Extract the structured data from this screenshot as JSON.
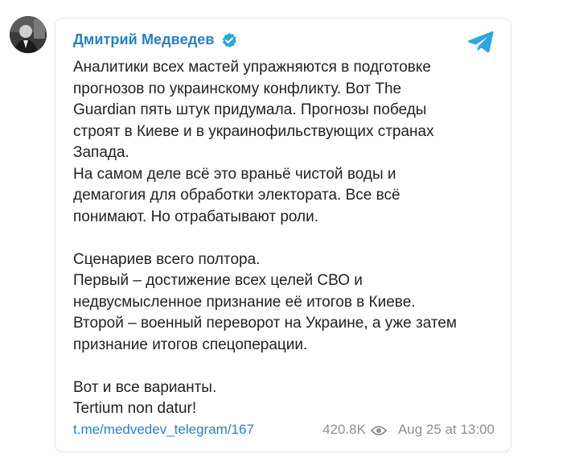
{
  "post": {
    "author": "Дмитрий Медведев",
    "body": "Аналитики всех мастей упражняются в подготовке\nпрогнозов по украинскому конфликту. Вот The\nGuardian пять штук придумала. Прогнозы победы\nстроят в Киеве и в украинофильствующих странах\nЗапада.\nНа самом деле всё это враньё чистой воды и\nдемагогия для обработки электората. Все всё\nпонимают. Но отрабатывают роли.\n\nСценариев всего полтора.\nПервый – достижение всех целей СВО и\nнедвусмысленное признание её итогов в Киеве.\nВторой – военный переворот на Украине, а уже затем\nпризнание итогов спецоперации.\n\nВот и все варианты.\nTertium non datur!",
    "link": "t.me/medvedev_telegram/167",
    "views": "420.8K",
    "date": "Aug 25 at 13:00"
  },
  "icons": {
    "verified": "verified-badge-icon",
    "telegram": "telegram-logo-icon",
    "views": "eye-icon"
  },
  "colors": {
    "accent": "#2481cc",
    "text": "#222222",
    "muted": "#8b9198",
    "border": "#e4e7ea",
    "telegram": "#2ca5e0"
  }
}
